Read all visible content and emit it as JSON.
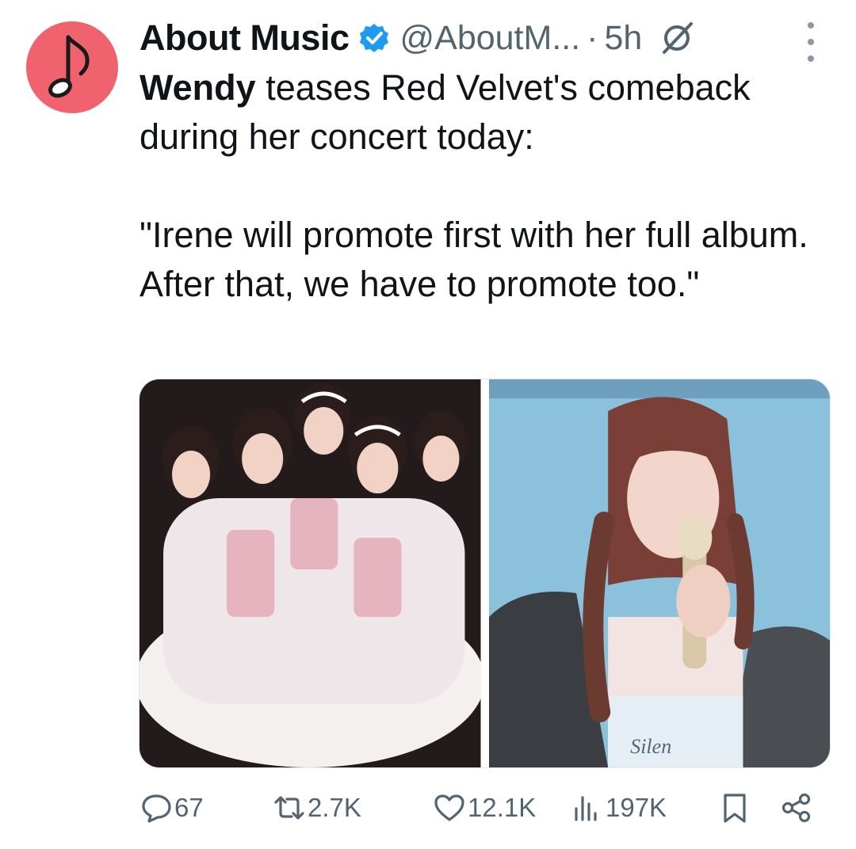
{
  "tweet": {
    "display_name": "About Music",
    "handle": "@AboutM...",
    "separator": "·",
    "time": "5h",
    "body_lead_bold": "Wendy",
    "body_lead_rest": " teases Red Velvet's comeback during her concert today:",
    "body_quote": "\"Irene will promote first with her full album. After that, we have to promote too.\"",
    "media_watermark": "Silen"
  },
  "actions": {
    "replies": "67",
    "reposts": "2.7K",
    "likes": "12.1K",
    "views": "197K"
  },
  "colors": {
    "avatar_bg": "#f0626d",
    "verified_badge": "#1d9bf0",
    "secondary_text": "#536471"
  },
  "icons": [
    "music-note-icon",
    "verified-badge-icon",
    "grok-icon",
    "more-icon",
    "reply-icon",
    "repost-icon",
    "like-icon",
    "views-icon",
    "bookmark-icon",
    "share-icon"
  ]
}
